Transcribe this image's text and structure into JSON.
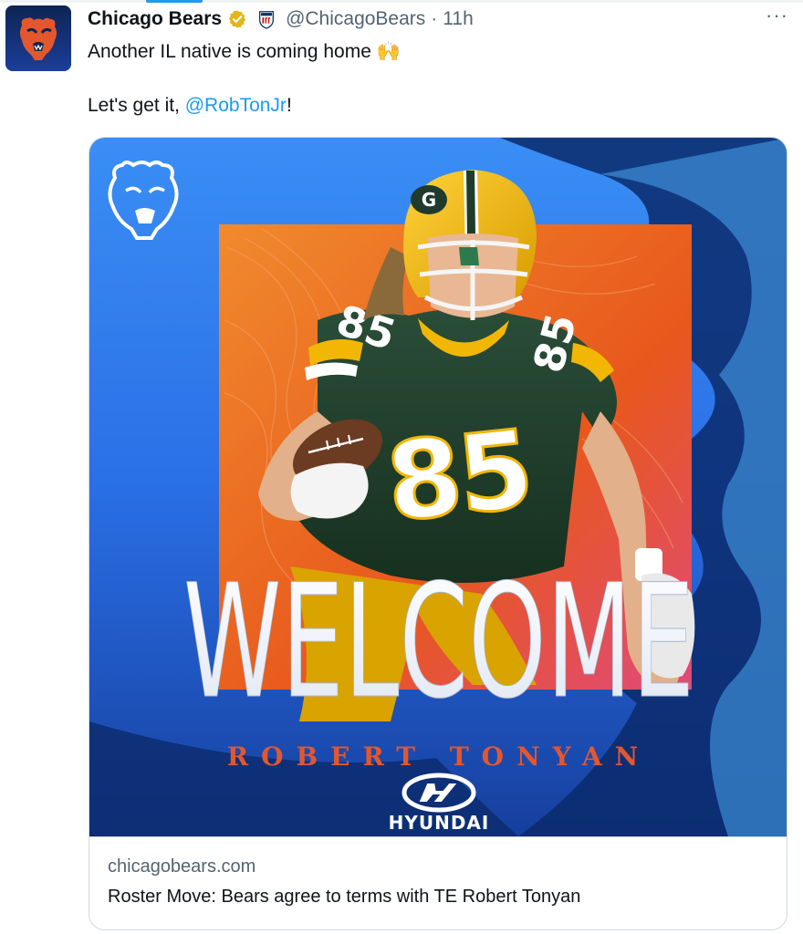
{
  "tweet": {
    "display_name": "Chicago Bears",
    "handle": "@ChicagoBears",
    "separator": "·",
    "time": "11h",
    "more_label": "···",
    "line1": "Another IL native is coming home 🙌",
    "line2_prefix": "Let's get it, ",
    "mention": "@RobTonJr",
    "line2_suffix": "!"
  },
  "media": {
    "welcome_text": "WELCOME",
    "player_name": "ROBERT TONYAN",
    "jersey_number": "85",
    "sponsor": "HYUNDAI",
    "helmet_logo": "G",
    "colors": {
      "background_blue": "#2a6fe6",
      "deep_blue": "#0b2a6b",
      "orange": "#e8581c",
      "jersey_green": "#1f3b2c",
      "helmet_yellow": "#f2b705",
      "name_orange": "#e4572e"
    }
  },
  "card": {
    "domain": "chicagobears.com",
    "title": "Roster Move: Bears agree to terms with TE Robert Tonyan"
  },
  "icons": {
    "verified": "verified-badge-icon",
    "nfl": "nfl-shield-icon",
    "bear": "bear-head-logo-icon"
  }
}
